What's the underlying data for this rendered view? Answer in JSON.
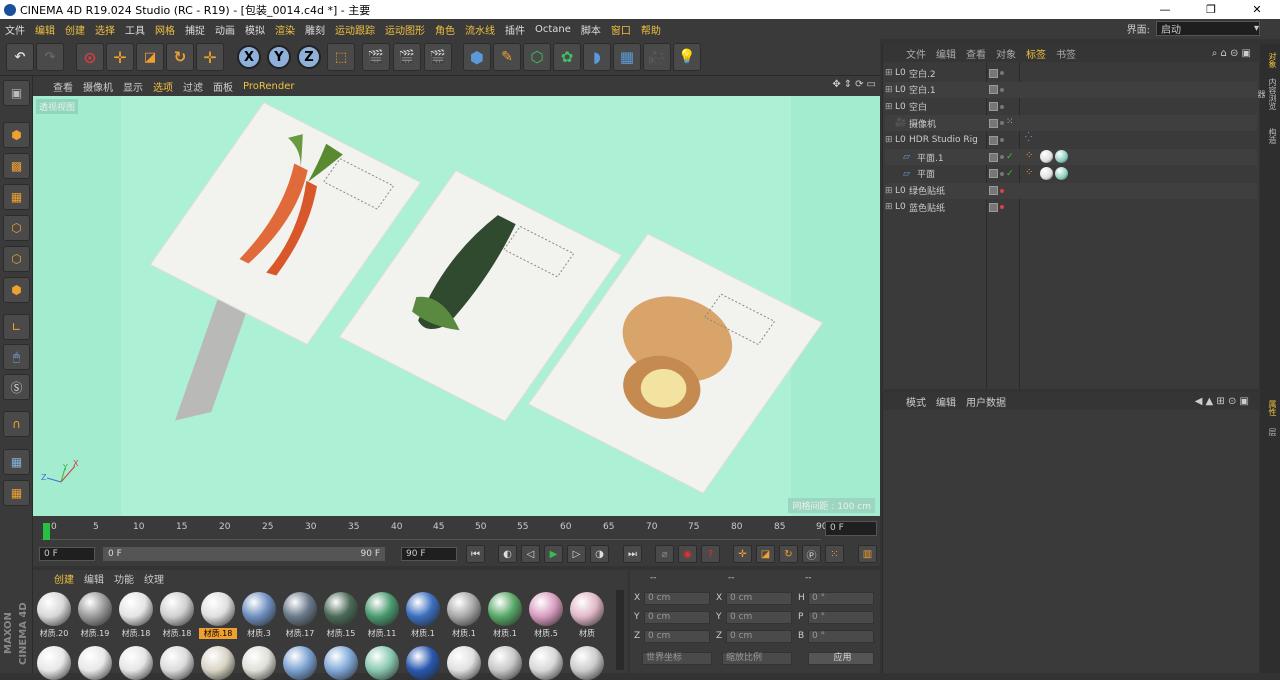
{
  "window": {
    "title": "CINEMA 4D R19.024 Studio (RC - R19) - [包装_0014.c4d *] - 主要",
    "minimize": "—",
    "restore": "❐",
    "close": "✕"
  },
  "menubar": {
    "items": [
      "文件",
      "编辑",
      "创建",
      "选择",
      "工具",
      "网格",
      "捕捉",
      "动画",
      "模拟",
      "渲染",
      "雕刻",
      "运动跟踪",
      "运动图形",
      "角色",
      "流水线",
      "插件",
      "Octane",
      "脚本",
      "窗口",
      "帮助"
    ],
    "layout_label": "界面:",
    "layout_value": "启动"
  },
  "toolbar": {
    "undo": "↶",
    "redo": "↷",
    "axis_x": "X",
    "axis_y": "Y",
    "axis_z": "Z"
  },
  "viewport": {
    "menu": [
      "查看",
      "摄像机",
      "显示",
      "选项",
      "过滤",
      "面板",
      "ProRender"
    ],
    "camera_tag": "透视视图",
    "grid_spacing": "网格间距 : 100 cm"
  },
  "timeline": {
    "ticks": [
      "0",
      "5",
      "10",
      "15",
      "20",
      "25",
      "30",
      "35",
      "40",
      "45",
      "50",
      "55",
      "60",
      "65",
      "70",
      "75",
      "80",
      "85",
      "90"
    ],
    "current_frame": "0 F",
    "start_frame": "0 F",
    "range_start": "0 F",
    "range_end": "90 F",
    "end_frame": "90 F"
  },
  "materials": {
    "menu": [
      "创建",
      "编辑",
      "功能",
      "纹理"
    ],
    "items": [
      {
        "label": "材质.20",
        "color": "#d8d8d8"
      },
      {
        "label": "材质.19",
        "color": "#9a9a9a"
      },
      {
        "label": "材质.18",
        "color": "#e4e4e4"
      },
      {
        "label": "材质.18",
        "color": "#d0d0d0"
      },
      {
        "label": "材质.18",
        "color": "#e0e0e0"
      },
      {
        "label": "材质.3",
        "color": "#6f8fc0"
      },
      {
        "label": "材质.17",
        "color": "#6a7a8a"
      },
      {
        "label": "材质.15",
        "color": "#4a6a56"
      },
      {
        "label": "材质.11",
        "color": "#4a9a70"
      },
      {
        "label": "材质.1",
        "color": "#3c6fc0"
      },
      {
        "label": "材质.1",
        "color": "#a8a8a8"
      },
      {
        "label": "材质.1",
        "color": "#58a868"
      },
      {
        "label": "材质.5",
        "color": "#d79cc0"
      },
      {
        "label": "材质",
        "color": "#e0b8c8"
      }
    ],
    "row2_colors": [
      "#e8e8e8",
      "#e8e8e8",
      "#e6e6e6",
      "#dcdcdc",
      "#d8d4c4",
      "#e0e0d8",
      "#7aa0d0",
      "#80a8d8",
      "#88c8b0",
      "#2858b0",
      "#e0e0e0",
      "#c8c8c8",
      "#d8d8d8",
      "#cccccc"
    ]
  },
  "coordinates": {
    "header": [
      "--",
      "--",
      "--"
    ],
    "pos": [
      {
        "axis": "X",
        "value": "0 cm"
      },
      {
        "axis": "Y",
        "value": "0 cm"
      },
      {
        "axis": "Z",
        "value": "0 cm"
      }
    ],
    "size": [
      {
        "axis": "X",
        "value": "0 cm"
      },
      {
        "axis": "Y",
        "value": "0 cm"
      },
      {
        "axis": "Z",
        "value": "0 cm"
      }
    ],
    "rot": [
      {
        "axis": "H",
        "value": "0 °"
      },
      {
        "axis": "P",
        "value": "0 °"
      },
      {
        "axis": "B",
        "value": "0 °"
      }
    ],
    "mode": "世界坐标",
    "scale_mode": "缩放比例",
    "apply": "应用"
  },
  "object_manager": {
    "menu": [
      "文件",
      "编辑",
      "查看",
      "对象",
      "标签",
      "书签"
    ],
    "objects": [
      {
        "name": "空白.2",
        "icon": "L0",
        "expand": "⊞"
      },
      {
        "name": "空白.1",
        "icon": "L0",
        "expand": "⊞"
      },
      {
        "name": "空白",
        "icon": "L0",
        "expand": "⊞"
      },
      {
        "name": "摄像机",
        "icon": "🎥",
        "expand": ""
      },
      {
        "name": "HDR Studio Rig",
        "icon": "L0",
        "expand": "⊞"
      },
      {
        "name": "平面.1",
        "icon": "▱",
        "expand": ""
      },
      {
        "name": "平面",
        "icon": "▱",
        "expand": ""
      },
      {
        "name": "绿色贴纸",
        "icon": "L0",
        "expand": "⊞"
      },
      {
        "name": "蓝色贴纸",
        "icon": "L0",
        "expand": "⊞"
      }
    ]
  },
  "attribute_manager": {
    "menu": [
      "模式",
      "编辑",
      "用户数据"
    ]
  },
  "right_tabs": [
    "对象",
    "内容浏览器",
    "构造",
    "属性",
    "层"
  ],
  "brand": "MAXON CINEMA 4D"
}
